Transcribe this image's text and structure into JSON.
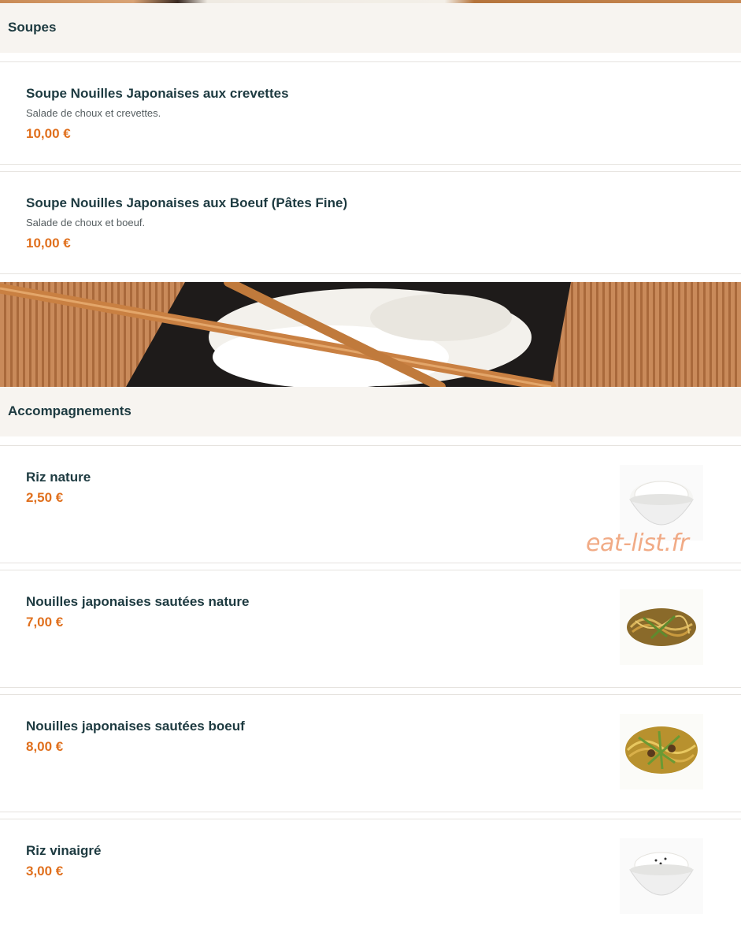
{
  "sections": [
    {
      "title": "Soupes",
      "items": [
        {
          "name": "Soupe Nouilles Japonaises aux crevettes",
          "description": "Salade de choux et crevettes.",
          "price": "10,00 €"
        },
        {
          "name": "Soupe Nouilles Japonaises aux Boeuf (Pâtes Fine)",
          "description": "Salade de choux et boeuf.",
          "price": "10,00 €"
        }
      ]
    },
    {
      "title": "Accompagnements",
      "items": [
        {
          "name": "Riz nature",
          "price": "2,50 €",
          "image_icon": "rice-bowl-icon"
        },
        {
          "name": "Nouilles japonaises sautées nature",
          "price": "7,00 €",
          "image_icon": "noodles-icon"
        },
        {
          "name": "Nouilles japonaises sautées boeuf",
          "price": "8,00 €",
          "image_icon": "noodles-beef-icon"
        },
        {
          "name": "Riz vinaigré",
          "price": "3,00 €",
          "image_icon": "vinegar-rice-bowl-icon"
        }
      ]
    }
  ],
  "watermark": "eat-list.fr",
  "colors": {
    "price": "#e0701e",
    "title": "#1d3a40",
    "header_bg": "#f7f4f0"
  }
}
